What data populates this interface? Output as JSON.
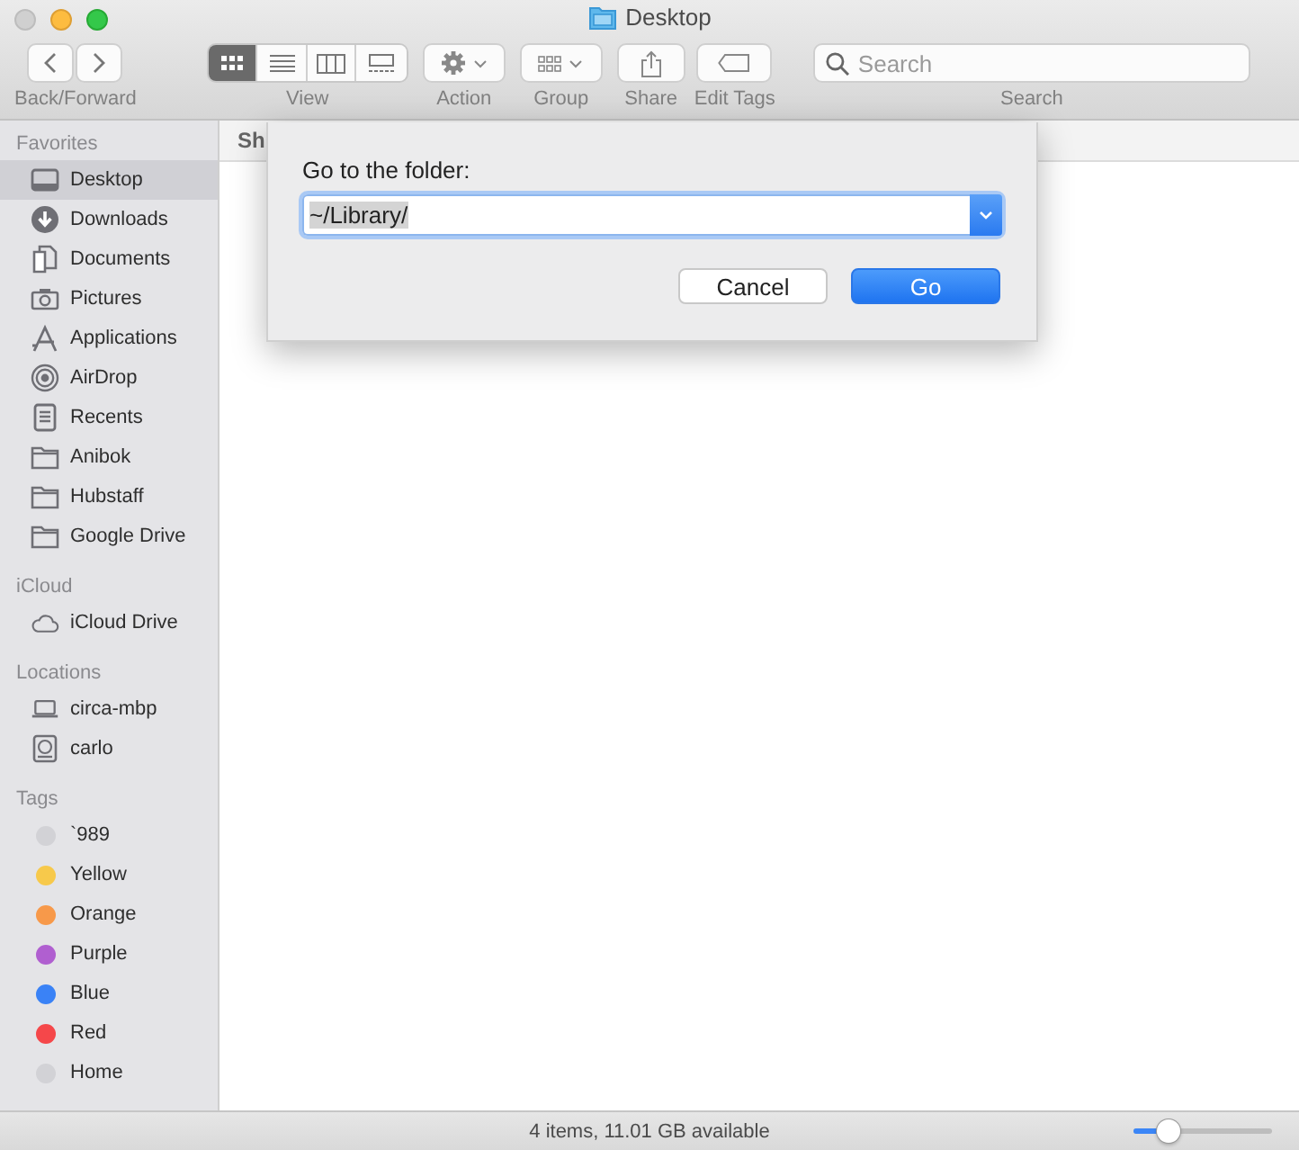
{
  "window": {
    "title": "Desktop",
    "close_disabled": true
  },
  "toolbar": {
    "navigation": {
      "label": "Back/Forward"
    },
    "view": {
      "label": "View",
      "modes": [
        {
          "kind": "icons",
          "selected": true
        },
        {
          "kind": "list",
          "selected": false
        },
        {
          "kind": "columns",
          "selected": false
        },
        {
          "kind": "gallery",
          "selected": false
        }
      ]
    },
    "action": {
      "label": "Action"
    },
    "group": {
      "label": "Group"
    },
    "share": {
      "label": "Share"
    },
    "edit_tags": {
      "label": "Edit Tags"
    },
    "search": {
      "placeholder": "Search",
      "label": "Search"
    }
  },
  "sidebar": {
    "sections": [
      {
        "title": "Favorites",
        "items": [
          {
            "label": "Desktop",
            "kind": "desktop",
            "selected": true
          },
          {
            "label": "Downloads",
            "kind": "downloads",
            "selected": false
          },
          {
            "label": "Documents",
            "kind": "documents",
            "selected": false
          },
          {
            "label": "Pictures",
            "kind": "pictures",
            "selected": false
          },
          {
            "label": "Applications",
            "kind": "applications",
            "selected": false
          },
          {
            "label": "AirDrop",
            "kind": "airdrop",
            "selected": false
          },
          {
            "label": "Recents",
            "kind": "recents",
            "selected": false
          },
          {
            "label": "Anibok",
            "kind": "folder",
            "selected": false
          },
          {
            "label": "Hubstaff",
            "kind": "folder",
            "selected": false
          },
          {
            "label": "Google Drive",
            "kind": "folder",
            "selected": false
          }
        ]
      },
      {
        "title": "iCloud",
        "items": [
          {
            "label": "iCloud Drive",
            "kind": "cloud",
            "selected": false
          }
        ]
      },
      {
        "title": "Locations",
        "items": [
          {
            "label": "circa-mbp",
            "kind": "laptop",
            "selected": false
          },
          {
            "label": "carlo",
            "kind": "disk",
            "selected": false
          }
        ]
      },
      {
        "title": "Tags",
        "items": [
          {
            "label": "`989",
            "kind": "tag",
            "color": "#d2d2d6",
            "selected": false
          },
          {
            "label": "Yellow",
            "kind": "tag",
            "color": "#f7c94b",
            "selected": false
          },
          {
            "label": "Orange",
            "kind": "tag",
            "color": "#f7994a",
            "selected": false
          },
          {
            "label": "Purple",
            "kind": "tag",
            "color": "#b05fd0",
            "selected": false
          },
          {
            "label": "Blue",
            "kind": "tag",
            "color": "#3a82f6",
            "selected": false
          },
          {
            "label": "Red",
            "kind": "tag",
            "color": "#f5474a",
            "selected": false
          },
          {
            "label": "Home",
            "kind": "tag",
            "color": "#d2d2d6",
            "selected": false
          }
        ]
      }
    ]
  },
  "content": {
    "column_header": "Sh"
  },
  "dialog": {
    "prompt": "Go to the folder:",
    "path": {
      "value": "~/Library/",
      "text_selected": true
    },
    "buttons": [
      {
        "label": "Cancel",
        "default": false
      },
      {
        "label": "Go",
        "default": true
      }
    ]
  },
  "status_bar": {
    "text": "4 items, 11.01 GB available",
    "icon_size": {
      "level": 0.25
    }
  }
}
